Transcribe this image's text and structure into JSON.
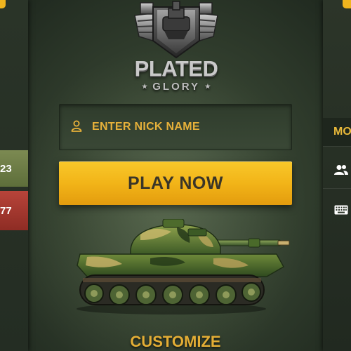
{
  "logo": {
    "title": "PLATED",
    "subtitle": "GLORY"
  },
  "nick_field": {
    "placeholder": "ENTER NICK NAME",
    "value": "",
    "icon": "user-icon"
  },
  "play_button": {
    "label": "PLAY NOW"
  },
  "customize": {
    "label": "CUSTOMIZE"
  },
  "left_panel": {
    "scores": [
      {
        "text": "23",
        "color": "#6c7c46"
      },
      {
        "text": "77",
        "color": "#a63a30"
      }
    ]
  },
  "right_panel": {
    "tab_label": "MO",
    "icons": [
      "users-icon",
      "keyboard-icon"
    ]
  },
  "colors": {
    "accent": "#f2b418",
    "text_gold": "#e6b03a",
    "panel": "#2a3428"
  }
}
